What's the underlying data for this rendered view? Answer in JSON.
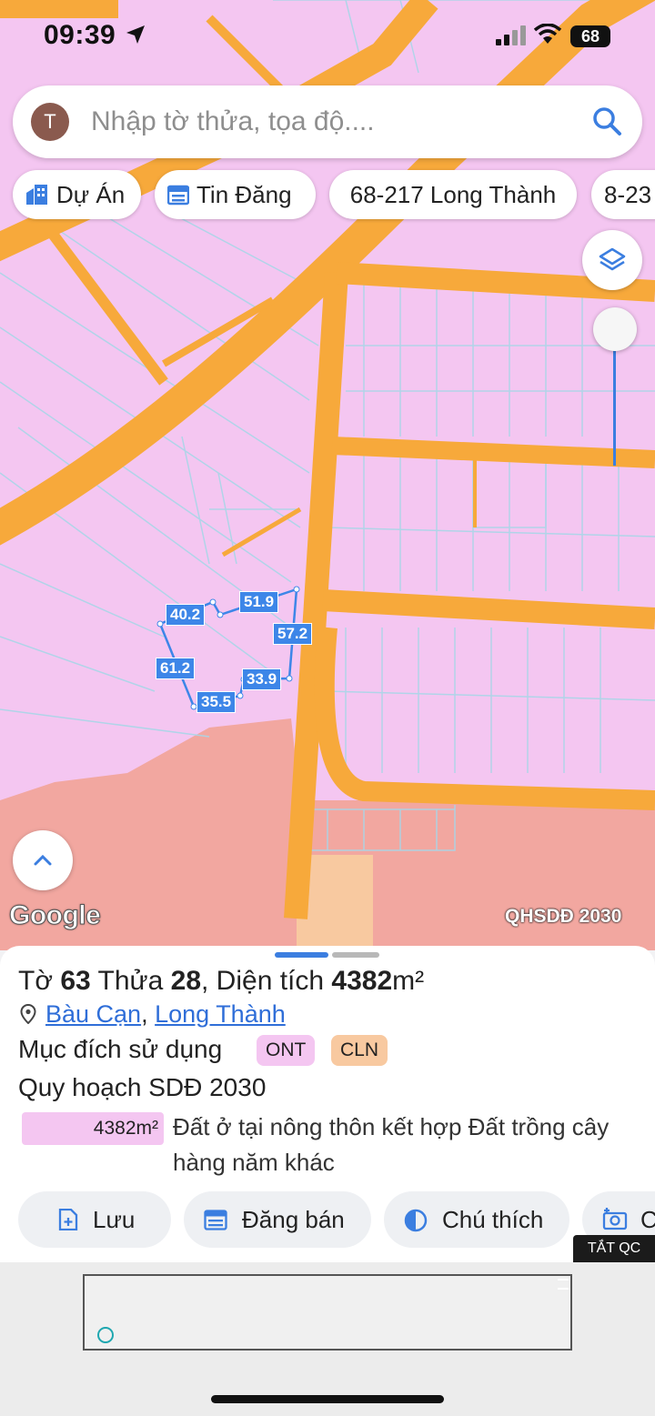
{
  "status_bar": {
    "time": "09:39",
    "battery": "68"
  },
  "search": {
    "avatar_letter": "T",
    "placeholder": "Nhập tờ thửa, tọa độ...."
  },
  "chips": [
    {
      "label": "Dự Án",
      "icon": "building-icon"
    },
    {
      "label": "Tin Đăng",
      "icon": "calendar-icon"
    },
    {
      "label": "68-217 Long Thành"
    },
    {
      "label": "8-23"
    }
  ],
  "map": {
    "google_logo": "Google",
    "layer_label": "QHSDĐ 2030",
    "dimensions": [
      "40.2",
      "51.9",
      "57.2",
      "61.2",
      "33.9",
      "35.5"
    ],
    "colors": {
      "residential": "#f4c6f1",
      "road": "#f7a93b",
      "forest": "#f2a7a0",
      "parcel_line": "#a9d6e8",
      "boundary": "#3d86e8"
    }
  },
  "parcel": {
    "title_prefix": "Tờ",
    "sheet": "63",
    "plot_label": "Thửa",
    "plot": "28",
    "area_label": ", Diện tích",
    "area": "4382",
    "unit": "m²",
    "commune": "Bàu Cạn",
    "district": "Long Thành",
    "separator": ",",
    "purpose_label": "Mục đích sử dụng",
    "purpose_codes": [
      {
        "code": "ONT",
        "color": "#f4c6f1"
      },
      {
        "code": "CLN",
        "color": "#f8c9a0"
      }
    ],
    "plan_label": "Quy hoạch SDĐ 2030",
    "plan_area": "4382m²",
    "plan_desc": "Đất ở tại nông thôn kết hợp Đất trồng cây hàng năm khác"
  },
  "actions": [
    {
      "label": "Lưu",
      "icon": "save-add-icon"
    },
    {
      "label": "Đăng bán",
      "icon": "calendar-icon"
    },
    {
      "label": "Chú thích",
      "icon": "contrast-icon"
    },
    {
      "label": "C",
      "icon": "camera-add-icon"
    }
  ],
  "ad": {
    "hide_label": "TẮT QC"
  }
}
